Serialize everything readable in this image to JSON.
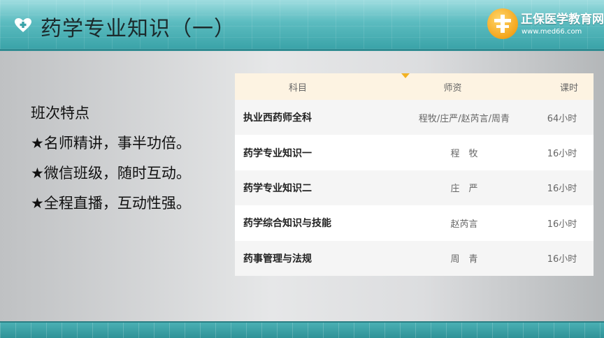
{
  "header": {
    "title": "药学专业知识（一）",
    "logo_name": "正保医学教育网",
    "logo_url": "www.med66.com"
  },
  "features": {
    "heading": "班次特点",
    "items": [
      "★名师精讲，事半功倍。",
      "★微信班级，随时互动。",
      "★全程直播，互动性强。"
    ]
  },
  "table": {
    "columns": [
      "科目",
      "师资",
      "课时"
    ],
    "rows": [
      {
        "subject": "执业西药师全科",
        "teacher": "程牧/庄严/赵芮言/周青",
        "hours": "64小时"
      },
      {
        "subject": "药学专业知识一",
        "teacher": "程　牧",
        "hours": "16小时"
      },
      {
        "subject": "药学专业知识二",
        "teacher": "庄　严",
        "hours": "16小时"
      },
      {
        "subject": "药学综合知识与技能",
        "teacher": "赵芮言",
        "hours": "16小时"
      },
      {
        "subject": "药事管理与法规",
        "teacher": "周　青",
        "hours": "16小时"
      }
    ]
  },
  "colors": {
    "header_teal": "#5cbcc0",
    "table_header_bg": "#fdf3e2",
    "accent_orange": "#f2b224"
  },
  "icons": {
    "heart": "heart-plus-icon",
    "logo": "medical-cross-logo-icon"
  }
}
